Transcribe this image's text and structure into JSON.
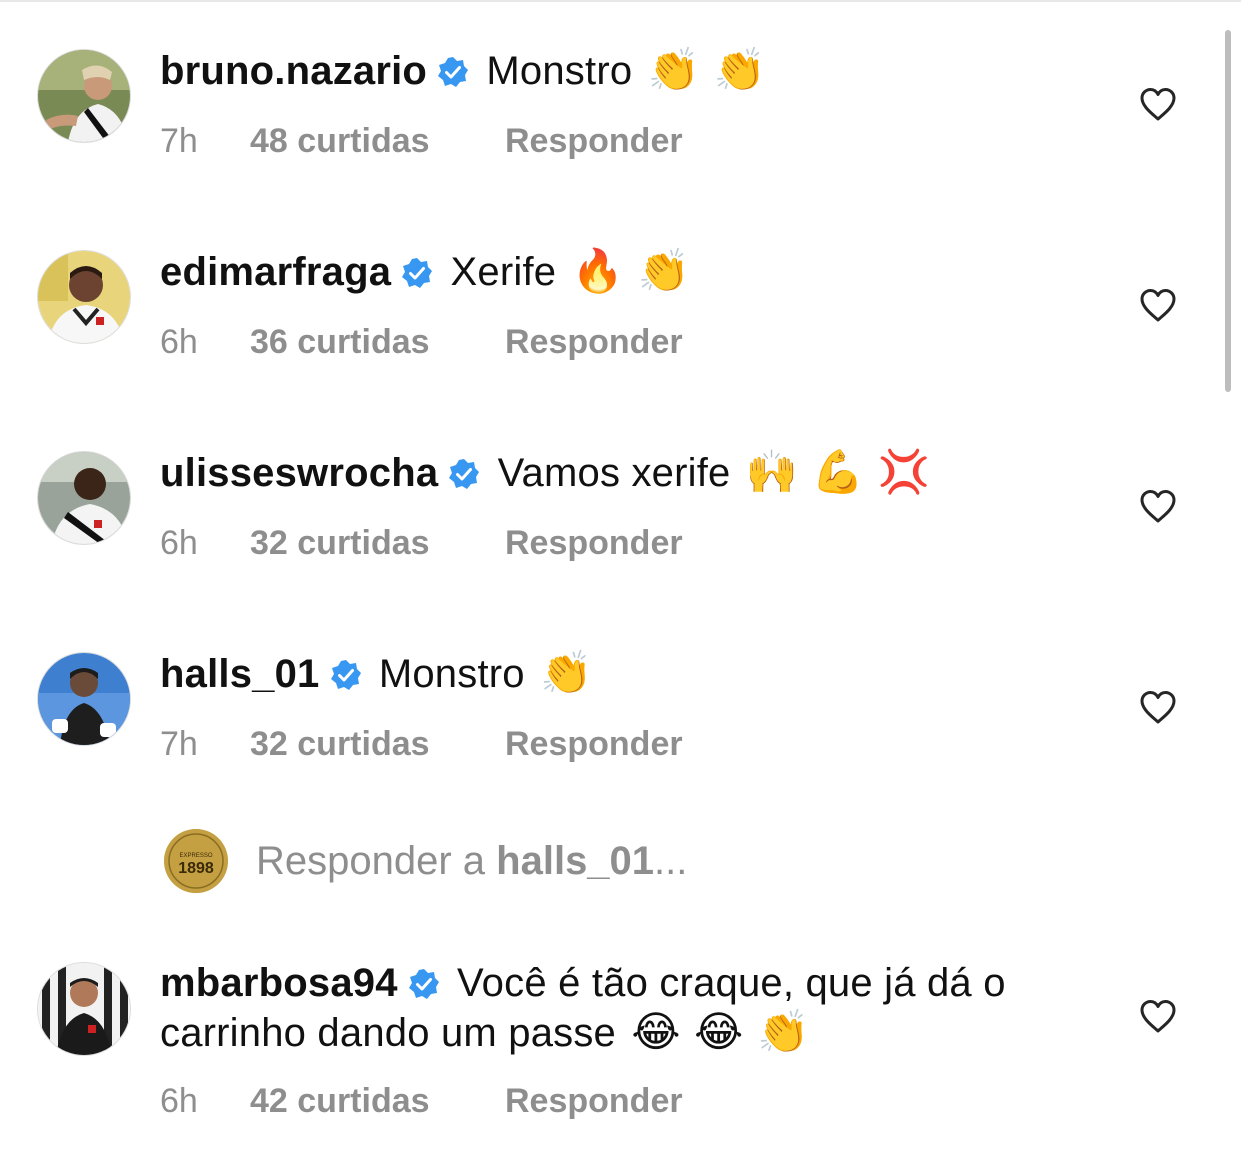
{
  "comments": [
    {
      "username": "bruno.nazario",
      "text": "Monstro",
      "emojis": "👏 👏",
      "time": "7h",
      "likes": "48 curtidas",
      "reply_label": "Responder"
    },
    {
      "username": "edimarfraga",
      "text": "Xerife",
      "emojis": "🔥 👏",
      "time": "6h",
      "likes": "36 curtidas",
      "reply_label": "Responder"
    },
    {
      "username": "ulisseswrocha",
      "text": "Vamos xerife",
      "emojis": "🙌 💪 💢",
      "time": "6h",
      "likes": "32 curtidas",
      "reply_label": "Responder"
    },
    {
      "username": "halls_01",
      "text": "Monstro",
      "emojis": "👏",
      "time": "7h",
      "likes": "32 curtidas",
      "reply_label": "Responder"
    },
    {
      "username": "mbarbosa94",
      "text": "Você é tão craque, que já dá o",
      "text_line2": "carrinho dando um passe",
      "emojis": "😂 😂 👏",
      "time": "6h",
      "likes": "42 curtidas",
      "reply_label": "Responder"
    }
  ],
  "reply_box": {
    "prefix": "Responder a ",
    "target": "halls_01",
    "suffix": "...",
    "avatar_text_top": "EXPRESSO",
    "avatar_text_main": "1898"
  },
  "icons": {
    "verified": "verified-badge-icon",
    "like": "heart-outline-icon"
  },
  "colors": {
    "verified_blue": "#3897f0",
    "meta_gray": "#8e8e8e",
    "reply_avatar_gold": "#c5a043"
  }
}
